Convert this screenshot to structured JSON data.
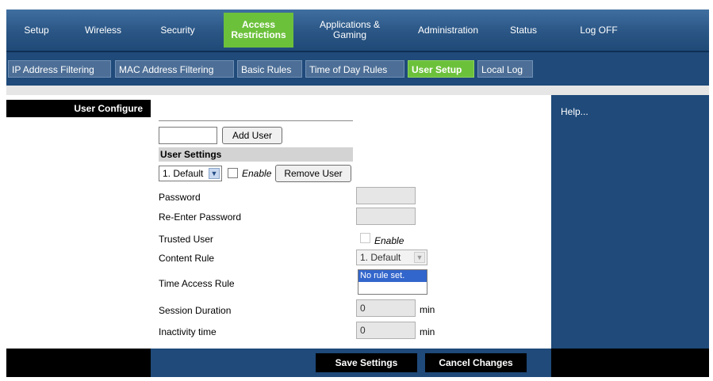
{
  "nav": {
    "items": [
      {
        "label": "Setup"
      },
      {
        "label": "Wireless"
      },
      {
        "label": "Security"
      },
      {
        "label": "Access Restrictions"
      },
      {
        "label": "Applications & Gaming"
      },
      {
        "label": "Administration"
      },
      {
        "label": "Status"
      },
      {
        "label": "Log OFF"
      }
    ],
    "active": "Access Restrictions",
    "accent_color": "#6cc13b",
    "bar_color": "#2a5584"
  },
  "subtabs": {
    "items": [
      {
        "label": "IP Address Filtering"
      },
      {
        "label": "MAC Address Filtering"
      },
      {
        "label": "Basic Rules"
      },
      {
        "label": "Time of Day Rules"
      },
      {
        "label": "User Setup"
      },
      {
        "label": "Local Log"
      }
    ],
    "active": "User Setup"
  },
  "left": {
    "title": "User Configure"
  },
  "form": {
    "new_user_value": "",
    "add_user_label": "Add User",
    "user_settings_heading": "User Settings",
    "user_select_value": "1. Default",
    "enable_label": "Enable",
    "remove_user_label": "Remove User",
    "password_label": "Password",
    "password_value": "",
    "reenter_password_label": "Re-Enter Password",
    "reenter_password_value": "",
    "trusted_user_label": "Trusted User",
    "trusted_enable_label": "Enable",
    "content_rule_label": "Content Rule",
    "content_rule_value": "1. Default",
    "time_access_rule_label": "Time Access Rule",
    "time_access_options": [
      "No rule set."
    ],
    "session_duration_label": "Session Duration",
    "session_duration_value": "0",
    "session_unit": "min",
    "inactivity_label": "Inactivity time",
    "inactivity_value": "0",
    "inactivity_unit": "min"
  },
  "help": {
    "text": "Help..."
  },
  "footer": {
    "save_label": "Save Settings",
    "cancel_label": "Cancel Changes"
  }
}
